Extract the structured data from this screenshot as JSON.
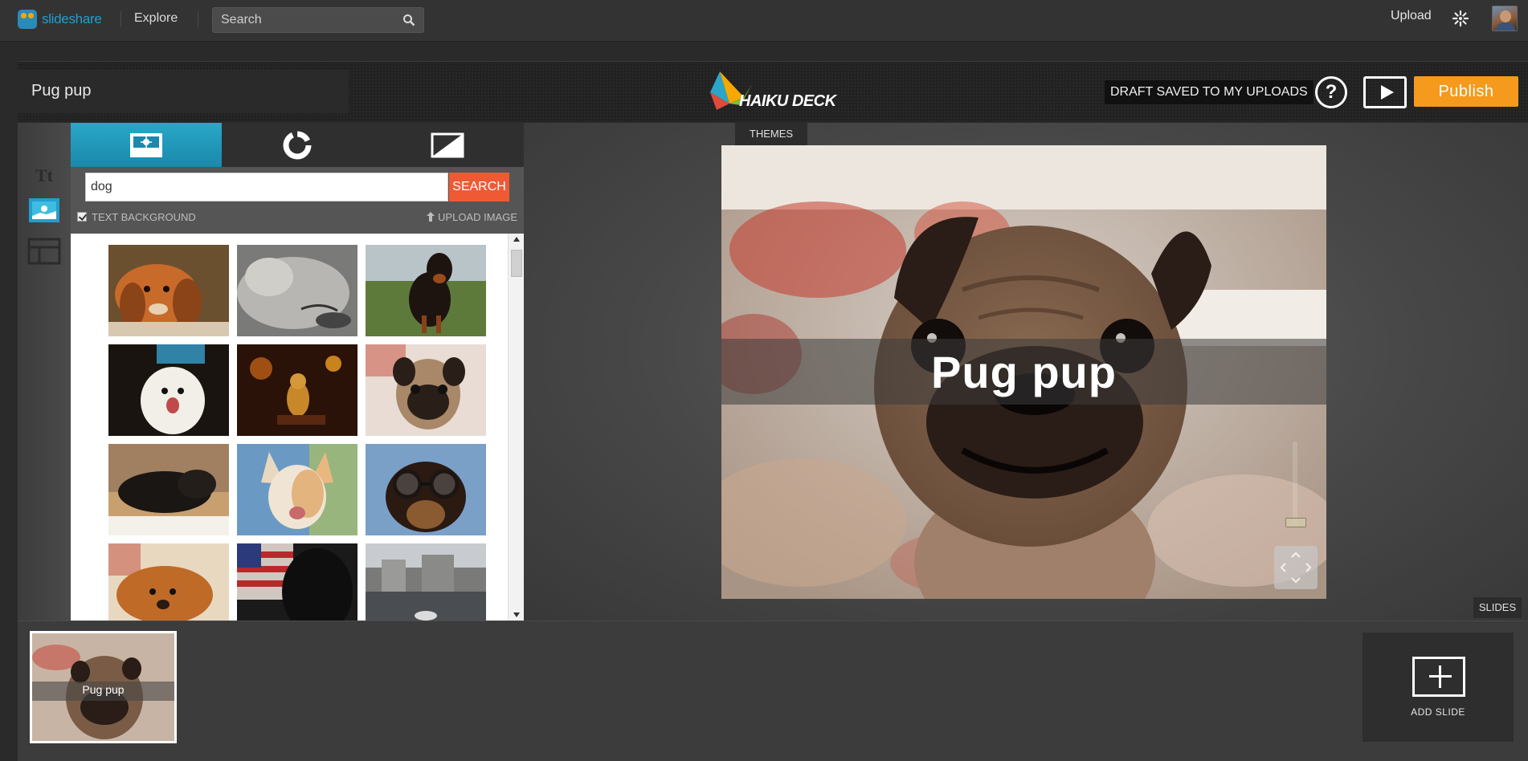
{
  "topbar": {
    "logo_text": "slideshare",
    "explore_label": "Explore",
    "search_placeholder": "Search",
    "upload_label": "Upload"
  },
  "header": {
    "deck_title": "Pug pup",
    "logo_text": "HAIKU DECK",
    "draft_status": "DRAFT SAVED TO MY UPLOADS",
    "help_label": "?",
    "publish_label": "Publish"
  },
  "tools": {
    "text_tool_label": "Tt"
  },
  "image_panel": {
    "tabs": [
      {
        "name": "image-tab",
        "active": true
      },
      {
        "name": "chart-tab",
        "active": false
      },
      {
        "name": "background-tab",
        "active": false
      }
    ],
    "search_value": "dog",
    "search_button": "SEARCH",
    "text_background_label": "TEXT BACKGROUND",
    "upload_image_label": "UPLOAD IMAGE",
    "thumbnails": [
      "cocker-spaniel",
      "sleeping-gray-dog",
      "black-tan-dog-field",
      "white-puppy",
      "puppy-lights",
      "pug-puppy",
      "black-dog-lying",
      "chihuahua",
      "dog-with-glasses",
      "golden-dog-resting",
      "dog-with-flag",
      "city-waterfront"
    ]
  },
  "canvas": {
    "themes_label": "THEMES",
    "slide_title": "Pug pup",
    "slides_label": "SLIDES"
  },
  "strip": {
    "slide_thumb_title": "Pug pup",
    "add_slide_label": "ADD SLIDE"
  },
  "colors": {
    "accent_blue": "#1fa0cf",
    "publish_orange": "#f59a1d",
    "search_red": "#ef5a35"
  }
}
